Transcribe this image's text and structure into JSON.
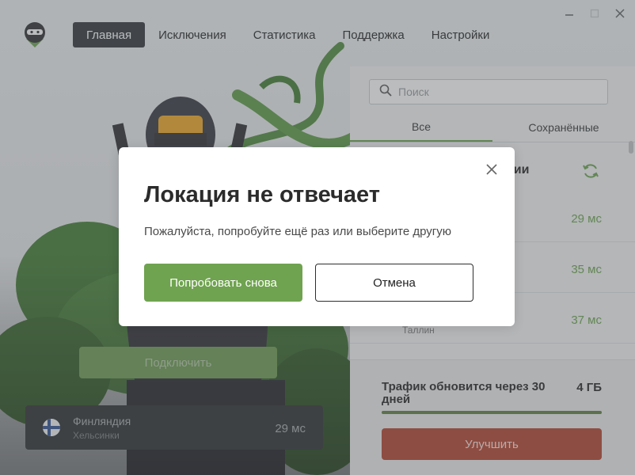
{
  "window": {
    "minimize_icon": "minimize-icon",
    "maximize_icon": "maximize-icon",
    "close_icon": "close-icon"
  },
  "nav": {
    "items": [
      {
        "label": "Главная",
        "active": true
      },
      {
        "label": "Исключения",
        "active": false
      },
      {
        "label": "Статистика",
        "active": false
      },
      {
        "label": "Поддержка",
        "active": false
      },
      {
        "label": "Настройки",
        "active": false
      }
    ]
  },
  "search": {
    "placeholder": "Поиск"
  },
  "tabs": [
    {
      "label": "Все",
      "active": true
    },
    {
      "label": "Сохранённые",
      "active": false
    }
  ],
  "locations": {
    "title_fragment": "кации",
    "rows": [
      {
        "ms": "29 мс",
        "sub": ""
      },
      {
        "ms": "35 мс",
        "sub": ""
      },
      {
        "ms": "37 мс",
        "sub": "Таллин"
      }
    ]
  },
  "traffic": {
    "text": "Трафик обновится через 30 дней",
    "amount": "4 ГБ",
    "progress": 1.0,
    "upgrade_label": "Улучшить"
  },
  "connect": {
    "label": "Подключить"
  },
  "current_location": {
    "country": "Финляндия",
    "city": "Хельсинки",
    "ms": "29 мс"
  },
  "modal": {
    "title": "Локация не отвечает",
    "message": "Пожалуйста, попробуйте ещё раз или выберите другую",
    "retry_label": "Попробовать снова",
    "cancel_label": "Отмена"
  },
  "colors": {
    "accent_green": "#6fa34f",
    "upgrade_red": "#b3402a",
    "nav_active_bg": "#2f3338"
  }
}
